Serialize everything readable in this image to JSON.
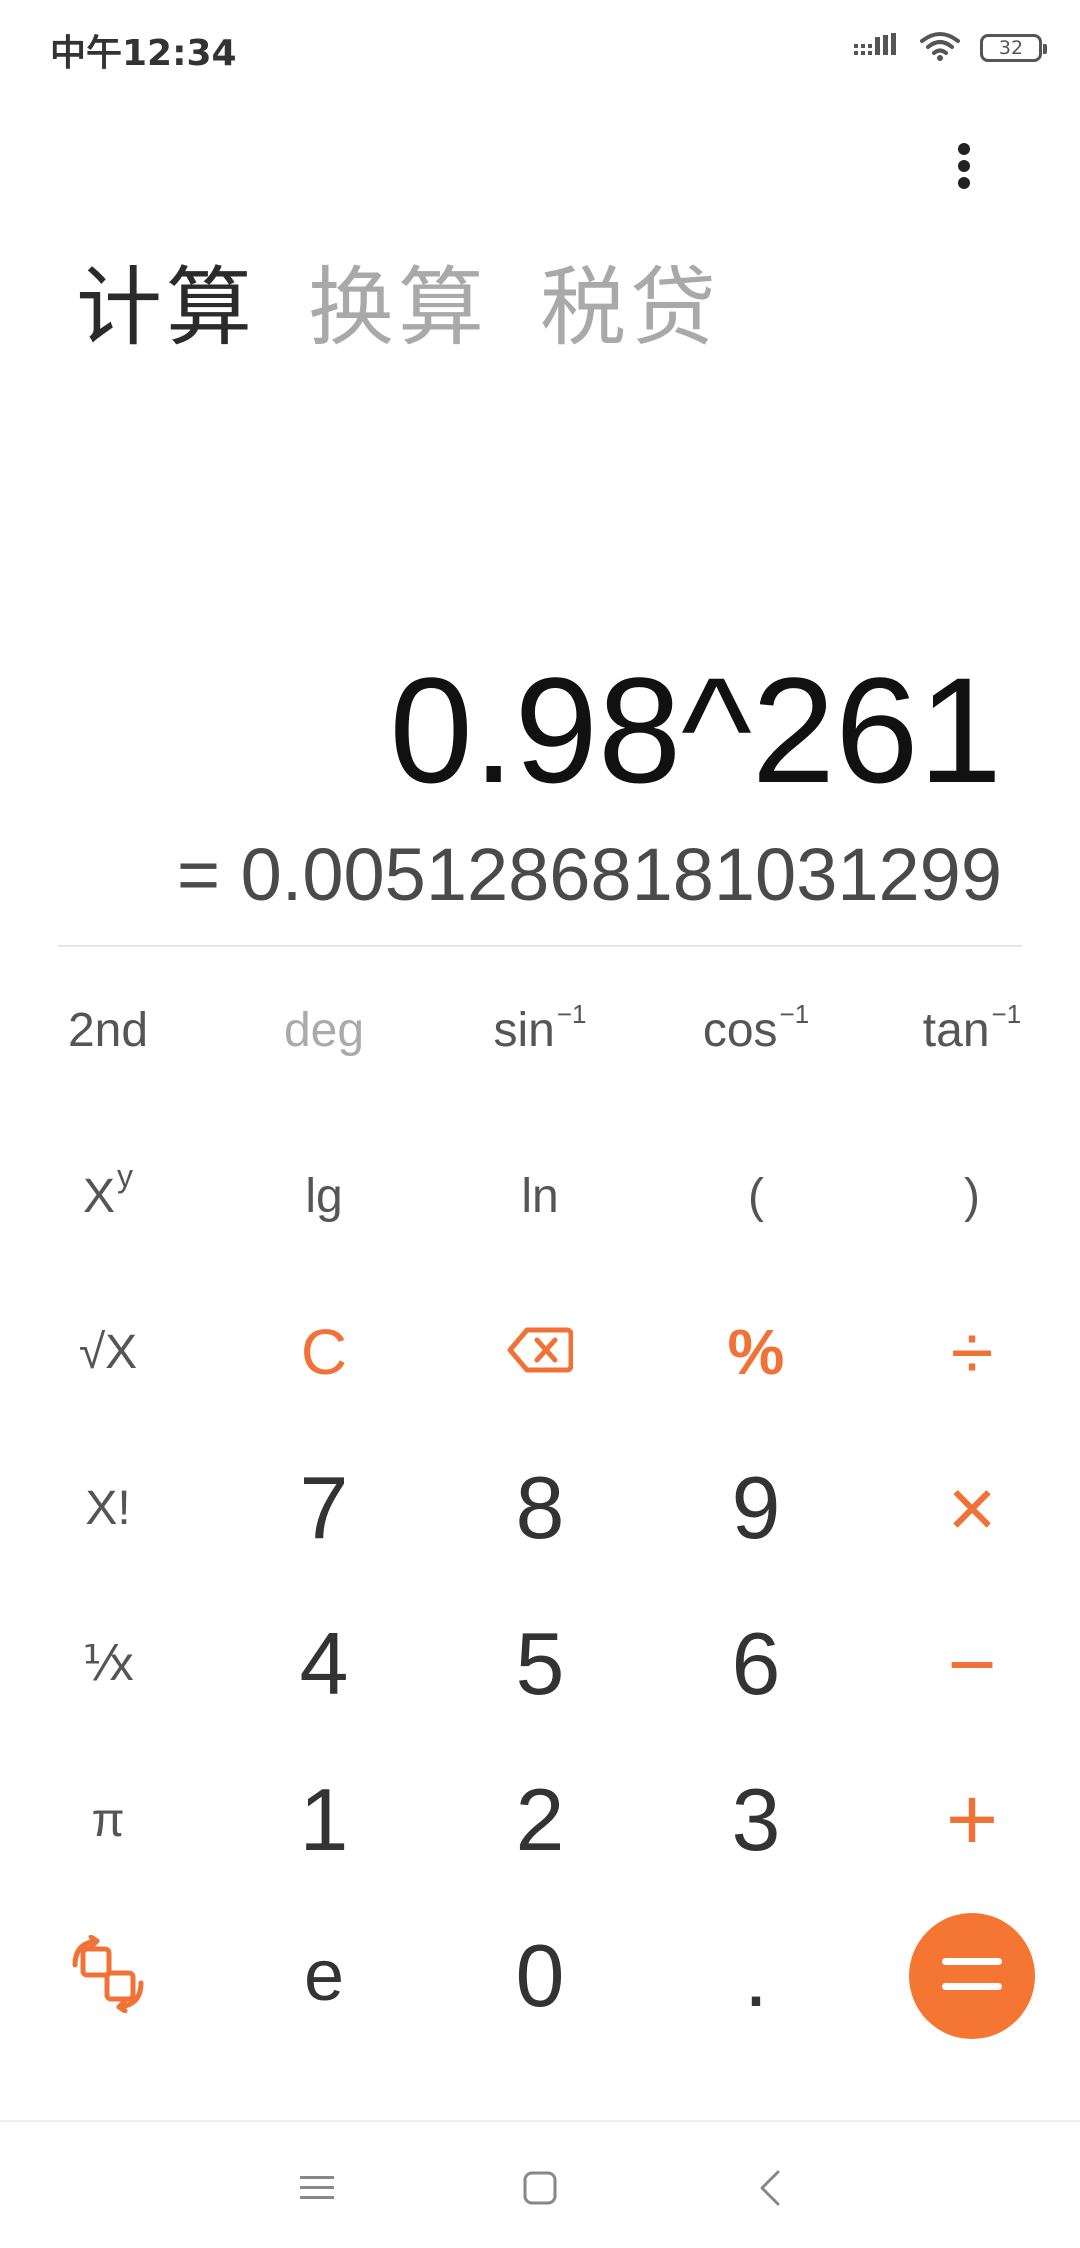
{
  "status_bar": {
    "time": "中午12:34",
    "battery": "32",
    "icons": [
      "signal-icon",
      "wifi-icon",
      "battery-icon"
    ]
  },
  "menu": {
    "icon": "more-vertical-icon"
  },
  "tabs": [
    {
      "label": "计算",
      "active": true
    },
    {
      "label": "换算",
      "active": false
    },
    {
      "label": "税贷",
      "active": false
    }
  ],
  "display": {
    "expression": "0.98^261",
    "result": "= 0.00512868181031299"
  },
  "keypad": {
    "row1": {
      "second": "2nd",
      "deg": "deg",
      "sin": "sin",
      "cos": "cos",
      "tan": "tan",
      "inverse_sup": "−1"
    },
    "row2": {
      "pow_base": "X",
      "pow_exp": "y",
      "lg": "lg",
      "ln": "ln",
      "open_paren": "(",
      "close_paren": ")"
    },
    "row3": {
      "sqrt": "√X",
      "clear": "C",
      "percent": "%",
      "divide": "÷"
    },
    "row4": {
      "factorial": "X!",
      "seven": "7",
      "eight": "8",
      "nine": "9",
      "multiply": "×"
    },
    "row5": {
      "reciprocal": "⅟x",
      "four": "4",
      "five": "5",
      "six": "6",
      "minus": "−"
    },
    "row6": {
      "pi": "π",
      "one": "1",
      "two": "2",
      "three": "3",
      "plus": "+"
    },
    "row7": {
      "e": "e",
      "zero": "0",
      "dot": "."
    }
  },
  "colors": {
    "accent": "#f47632",
    "text_primary": "#111111",
    "text_secondary": "#4a4a4a",
    "tab_inactive": "#a9a9a9"
  },
  "nav": {
    "icons": [
      "menu-lines-icon",
      "home-square-icon",
      "back-chevron-icon"
    ]
  }
}
